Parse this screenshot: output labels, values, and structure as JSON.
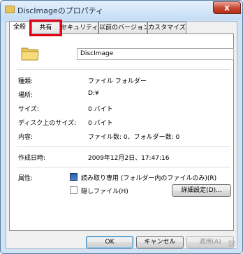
{
  "window": {
    "title": "DiscImageのプロパティ",
    "close_glyph": "x",
    "icon": "folder-icon"
  },
  "tabs": [
    {
      "label": "全般",
      "active": true
    },
    {
      "label": "共有",
      "active": false
    },
    {
      "label": "セキュリティ",
      "active": false
    },
    {
      "label": "以前のバージョン",
      "active": false
    },
    {
      "label": "カスタマイズ",
      "active": false
    }
  ],
  "general": {
    "name": "DiscImage",
    "rows": [
      {
        "label": "種類:",
        "value": "ファイル フォルダー"
      },
      {
        "label": "場所:",
        "value": "D:¥"
      },
      {
        "label": "サイズ:",
        "value": "0 バイト"
      },
      {
        "label": "ディスク上のサイズ:",
        "value": "0 バイト"
      },
      {
        "label": "内容:",
        "value": "ファイル数: 0、フォルダー数: 0"
      }
    ],
    "created_label": "作成日時:",
    "created_value": "2009年12月2日、17:47:16",
    "attributes_label": "属性:",
    "readonly_label": "読み取り専用 (フォルダー内のファイルのみ)(R)",
    "hidden_label": "隠しファイル(H)",
    "advanced_button": "詳細設定(D)..."
  },
  "buttons": {
    "ok": "OK",
    "cancel": "キャンセル",
    "apply": "適用(A)"
  },
  "colors": {
    "highlight": "#e60012",
    "title_bg": "#cfe3f5",
    "close": "#c7432c"
  }
}
